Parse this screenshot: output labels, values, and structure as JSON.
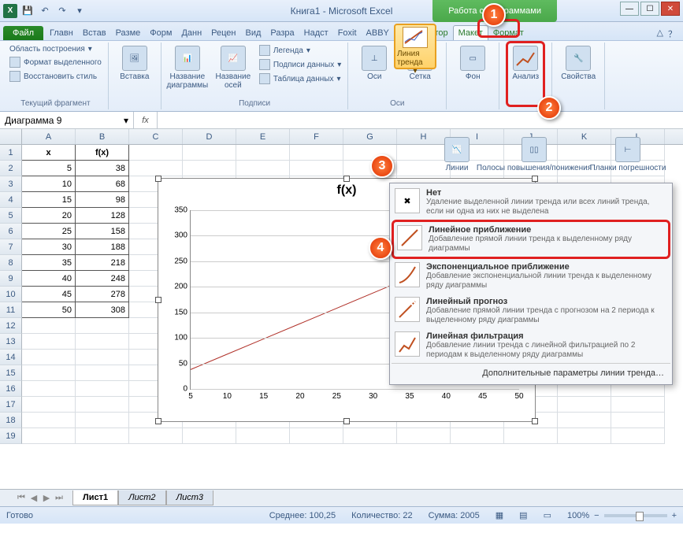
{
  "window": {
    "title": "Книга1 - Microsoft Excel",
    "chart_tools": "Работа с диаграммами"
  },
  "tabs": {
    "file": "Файл",
    "list": [
      "Главн",
      "Встав",
      "Разме",
      "Форм",
      "Данн",
      "Рецен",
      "Вид",
      "Разра",
      "Надст",
      "Foxit",
      "ABBY"
    ],
    "ctx": [
      "Конструктор",
      "Макет",
      "Формат"
    ],
    "active_ctx": "Макет"
  },
  "ribbon": {
    "sel_area": "Область построения",
    "fmt_sel": "Формат выделенного",
    "reset": "Восстановить стиль",
    "grp_current": "Текущий фрагмент",
    "insert": "Вставка",
    "chart_title": "Название диаграммы",
    "axis_title": "Название осей",
    "legend": "Легенда",
    "data_labels": "Подписи данных",
    "data_table": "Таблица данных",
    "grp_labels": "Подписи",
    "axes": "Оси",
    "grid": "Сетка",
    "grp_axes": "Оси",
    "bg": "Фон",
    "analysis": "Анализ",
    "props": "Свойства"
  },
  "analysis_sub": {
    "trendline": "Линия тренда",
    "lines": "Линии",
    "bars": "Полосы повышения/понижения",
    "errbars": "Планки погрешности"
  },
  "menu": {
    "none_t": "Нет",
    "none_d": "Удаление выделенной линии тренда или всех линий тренда, если ни одна из них не выделена",
    "lin_t": "Линейное приближение",
    "lin_d": "Добавление прямой линии тренда к выделенному ряду диаграммы",
    "exp_t": "Экспоненциальное приближение",
    "exp_d": "Добавление экспоненциальной линии тренда к выделенному ряду диаграммы",
    "fc_t": "Линейный прогноз",
    "fc_d": "Добавление прямой линии тренда с прогнозом на 2 периода к выделенному ряду диаграммы",
    "ma_t": "Линейная фильтрация",
    "ma_d": "Добавление линии тренда с линейной фильтрацией по 2 периодам к выделенному ряду диаграммы",
    "more": "Дополнительные параметры линии тренда…"
  },
  "namebox": "Диаграмма 9",
  "sheet": {
    "cols": [
      "A",
      "B",
      "C",
      "D",
      "E",
      "F",
      "G",
      "H",
      "I",
      "J",
      "K",
      "L"
    ],
    "headers": {
      "A": "x",
      "B": "f(x)"
    },
    "data": [
      {
        "x": 5,
        "fx": 38
      },
      {
        "x": 10,
        "fx": 68
      },
      {
        "x": 15,
        "fx": 98
      },
      {
        "x": 20,
        "fx": 128
      },
      {
        "x": 25,
        "fx": 158
      },
      {
        "x": 30,
        "fx": 188
      },
      {
        "x": 35,
        "fx": 218
      },
      {
        "x": 40,
        "fx": 248
      },
      {
        "x": 45,
        "fx": 278
      },
      {
        "x": 50,
        "fx": 308
      }
    ],
    "tabs": [
      "Лист1",
      "Лист2",
      "Лист3"
    ]
  },
  "chart_data": {
    "type": "line",
    "title": "f(x)",
    "x": [
      5,
      10,
      15,
      20,
      25,
      30,
      35,
      40,
      45,
      50
    ],
    "y": [
      38,
      68,
      98,
      128,
      158,
      188,
      218,
      248,
      278,
      308
    ],
    "ylim": [
      0,
      350
    ],
    "y_ticks": [
      0,
      50,
      100,
      150,
      200,
      250,
      300,
      350
    ],
    "x_ticks": [
      5,
      10,
      15,
      20,
      25,
      30,
      35,
      40,
      45,
      50
    ]
  },
  "status": {
    "ready": "Готово",
    "avg_l": "Среднее:",
    "avg_v": "100,25",
    "cnt_l": "Количество:",
    "cnt_v": "22",
    "sum_l": "Сумма:",
    "sum_v": "2005",
    "zoom": "100%"
  }
}
